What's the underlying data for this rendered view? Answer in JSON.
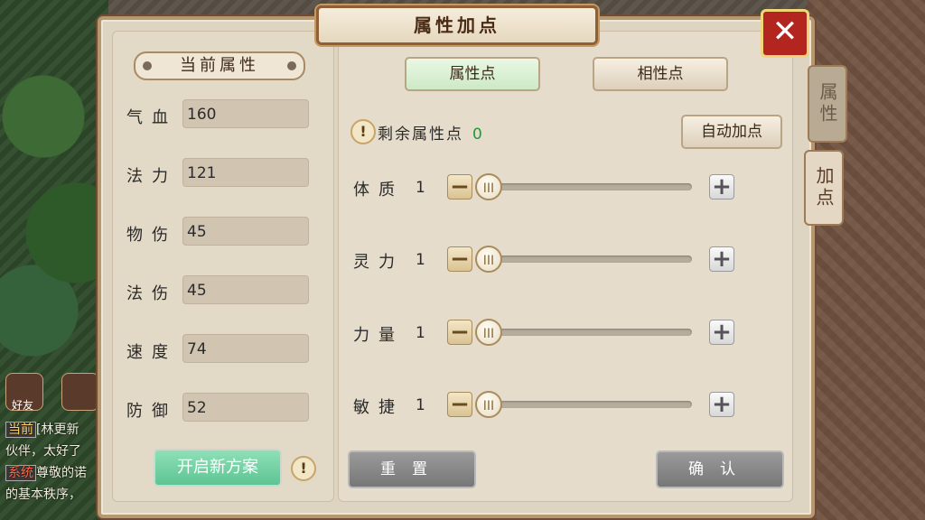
{
  "window": {
    "title": "属性加点",
    "close_symbol": "✕"
  },
  "tabs": [
    {
      "label": "属性",
      "active": false
    },
    {
      "label": "加点",
      "active": true
    }
  ],
  "left_panel": {
    "section_title": "当前属性",
    "stats": [
      {
        "label": "气血",
        "value": "160"
      },
      {
        "label": "法力",
        "value": "121"
      },
      {
        "label": "物伤",
        "value": "45"
      },
      {
        "label": "法伤",
        "value": "45"
      },
      {
        "label": "速度",
        "value": "74"
      },
      {
        "label": "防御",
        "value": "52"
      }
    ],
    "new_plan_button": "开启新方案",
    "info_symbol": "!"
  },
  "right_panel": {
    "toggle_attr": "属性点",
    "toggle_affinity": "相性点",
    "remaining_label": "剩余属性点",
    "remaining_value": "0",
    "auto_button": "自动加点",
    "attributes": [
      {
        "label": "体质",
        "value": "1",
        "slider_fraction": 0
      },
      {
        "label": "灵力",
        "value": "1",
        "slider_fraction": 0
      },
      {
        "label": "力量",
        "value": "1",
        "slider_fraction": 0
      },
      {
        "label": "敏捷",
        "value": "1",
        "slider_fraction": 0
      }
    ],
    "reset_button": "重置",
    "confirm_button": "确认",
    "slider_knob_glyph": "III"
  },
  "chat": {
    "friend_label": "好友",
    "lines": [
      {
        "tag": "当前",
        "text": "[林更新"
      },
      {
        "tag": "",
        "text": "伙伴，太好了"
      },
      {
        "tag": "系统",
        "text": "尊敬的诺"
      },
      {
        "tag": "",
        "text": "的基本秩序，"
      }
    ]
  }
}
